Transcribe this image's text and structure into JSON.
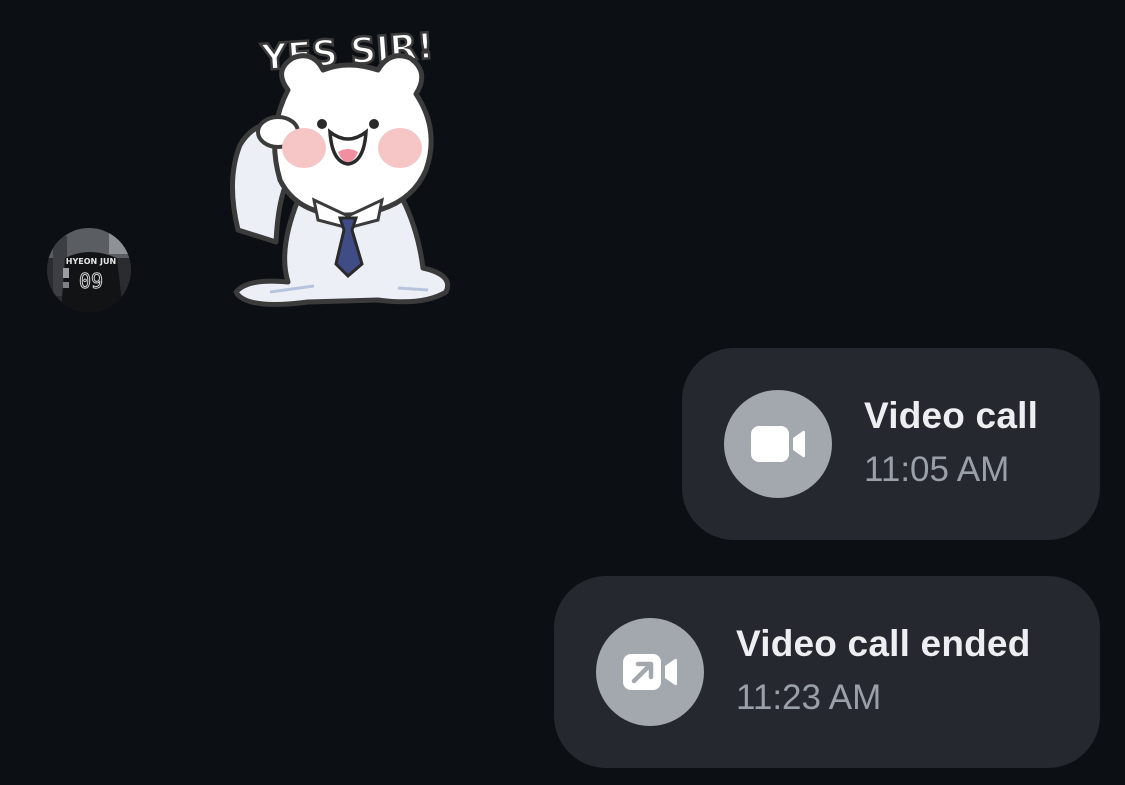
{
  "incoming_message": {
    "avatar": {
      "jersey_name": "HYEON JUN",
      "jersey_number": "09"
    },
    "sticker": {
      "caption": "YES SIR!",
      "icon": "bear-salute-sticker"
    }
  },
  "outgoing_messages": [
    {
      "title": "Video call",
      "time": "11:05 AM",
      "icon": "video-camera-icon"
    },
    {
      "title": "Video call ended",
      "time": "11:23 AM",
      "icon": "video-call-ended-icon"
    }
  ],
  "colors": {
    "background": "#0c0f13",
    "bubble": "#25282e",
    "icon_circle": "#a3a7ae",
    "title_text": "#eceef1",
    "time_text": "#9aa0a8"
  }
}
